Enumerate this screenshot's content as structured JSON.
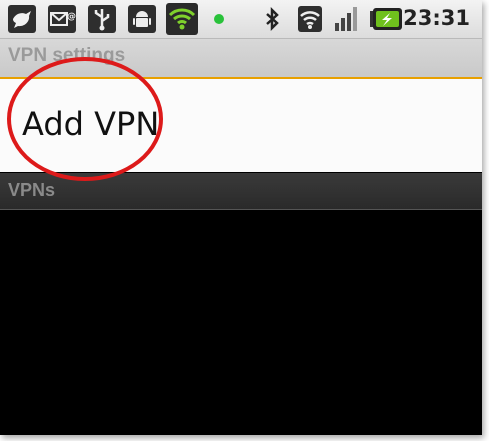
{
  "status_bar": {
    "time": "23:31",
    "icons": [
      "twitter-bird-icon",
      "email-icon",
      "usb-icon",
      "android-debug-icon",
      "wifi-hotspot-icon",
      "notification-led-icon",
      "bluetooth-icon",
      "wifi-signal-icon",
      "cell-signal-icon",
      "battery-charging-icon"
    ]
  },
  "header": {
    "title": "VPN settings"
  },
  "add_vpn": {
    "label": "Add VPN"
  },
  "section": {
    "label": "VPNs"
  },
  "colors": {
    "accent": "#e8a000",
    "highlight_circle": "#dd1a1a"
  }
}
